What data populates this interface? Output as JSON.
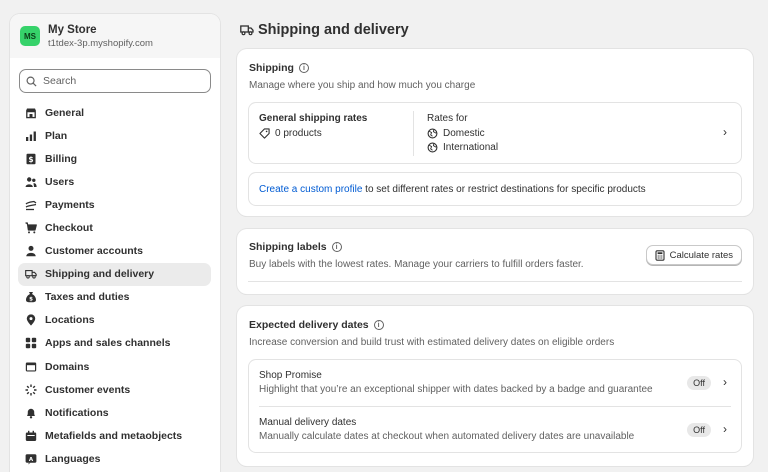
{
  "store": {
    "initials": "MS",
    "name": "My Store",
    "domain": "t1tdex-3p.myshopify.com"
  },
  "search": {
    "placeholder": "Search"
  },
  "nav": [
    {
      "label": "General",
      "icon": "store-icon"
    },
    {
      "label": "Plan",
      "icon": "plan-chart-icon"
    },
    {
      "label": "Billing",
      "icon": "billing-icon"
    },
    {
      "label": "Users",
      "icon": "users-icon"
    },
    {
      "label": "Payments",
      "icon": "payments-icon"
    },
    {
      "label": "Checkout",
      "icon": "cart-icon"
    },
    {
      "label": "Customer accounts",
      "icon": "person-icon"
    },
    {
      "label": "Shipping and delivery",
      "icon": "truck-icon",
      "active": true
    },
    {
      "label": "Taxes and duties",
      "icon": "taxes-icon"
    },
    {
      "label": "Locations",
      "icon": "location-pin-icon"
    },
    {
      "label": "Apps and sales channels",
      "icon": "apps-icon"
    },
    {
      "label": "Domains",
      "icon": "domains-icon"
    },
    {
      "label": "Customer events",
      "icon": "events-icon"
    },
    {
      "label": "Notifications",
      "icon": "bell-icon"
    },
    {
      "label": "Metafields and metaobjects",
      "icon": "metafields-icon"
    },
    {
      "label": "Languages",
      "icon": "languages-icon"
    }
  ],
  "page": {
    "title": "Shipping and delivery"
  },
  "shipping": {
    "title": "Shipping",
    "subtitle": "Manage where you ship and how much you charge",
    "rates_title": "General shipping rates",
    "products": "0 products",
    "rates_for": "Rates for",
    "zones": [
      "Domestic",
      "International"
    ],
    "custom_link": "Create a custom profile",
    "custom_rest": " to set different rates or restrict destinations for specific products"
  },
  "labels": {
    "title": "Shipping labels",
    "subtitle": "Buy labels with the lowest rates. Manage your carriers to fulfill orders faster.",
    "button": "Calculate rates"
  },
  "delivery": {
    "title": "Expected delivery dates",
    "subtitle": "Increase conversion and build trust with estimated delivery dates on eligible orders",
    "items": [
      {
        "title": "Shop Promise",
        "desc": "Highlight that you’re an exceptional shipper with dates backed by a badge and guarantee",
        "status": "Off"
      },
      {
        "title": "Manual delivery dates",
        "desc": "Manually calculate dates at checkout when automated delivery dates are unavailable",
        "status": "Off"
      }
    ]
  },
  "colors": {
    "accent_link": "#005bd3",
    "avatar_bg": "#36d26a",
    "page_bg": "#f1f1f1"
  }
}
